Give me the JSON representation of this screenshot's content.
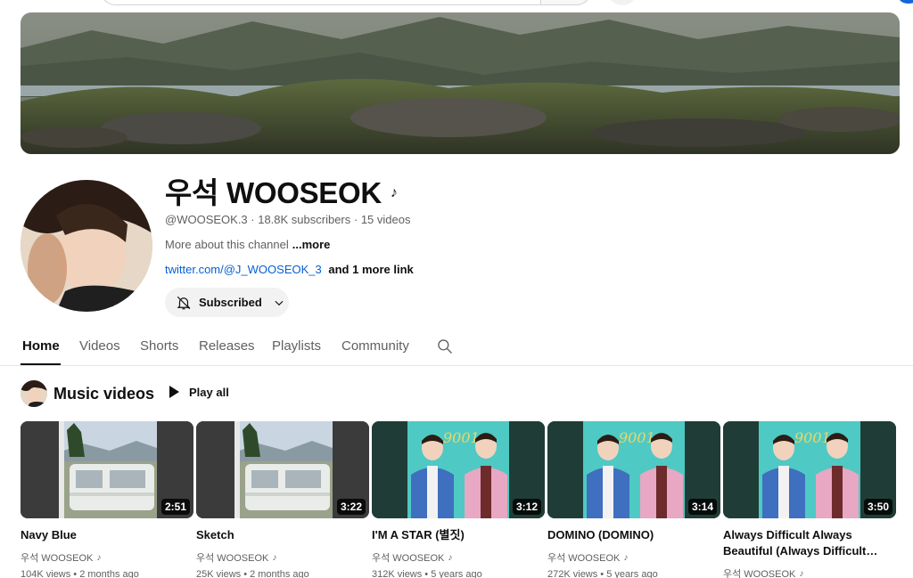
{
  "channel": {
    "name": "우석 WOOSEOK",
    "name_badge_icon": "music-note-icon",
    "handle_line": "@WOOSEOK.3 · 18.8K subscribers · 15 videos",
    "about": "More about this channel",
    "about_more": "...more",
    "link": "twitter.com/@J_WOOSEOK_3",
    "link_extra": "and 1 more link",
    "subscribe_label": "Subscribed"
  },
  "tabs": [
    {
      "label": "Home",
      "active": true
    },
    {
      "label": "Videos"
    },
    {
      "label": "Shorts"
    },
    {
      "label": "Releases"
    },
    {
      "label": "Playlists"
    },
    {
      "label": "Community"
    }
  ],
  "section": {
    "title": "Music videos",
    "play_all": "Play all"
  },
  "videos": [
    {
      "title": "Navy Blue",
      "duration": "2:51",
      "channel": "우석 WOOSEOK",
      "stats": "104K views • 2 months ago",
      "thumb": "car"
    },
    {
      "title": "Sketch",
      "duration": "3:22",
      "channel": "우석 WOOSEOK",
      "stats": "25K views • 2 months ago",
      "thumb": "car"
    },
    {
      "title": "I'M A STAR (별짓)",
      "duration": "3:12",
      "channel": "우석 WOOSEOK",
      "stats": "312K views • 5 years ago",
      "thumb": "duo"
    },
    {
      "title": "DOMINO (DOMINO)",
      "duration": "3:14",
      "channel": "우석 WOOSEOK",
      "stats": "272K views • 5 years ago",
      "thumb": "duo"
    },
    {
      "title": "Always Difficult Always Beautiful (Always Difficult…",
      "duration": "3:50",
      "channel": "우석 WOOSEOK",
      "stats": "",
      "thumb": "duo"
    }
  ],
  "colors": {
    "link": "#065fd4",
    "text": "#0f0f0f",
    "secondary": "#606060",
    "chip_bg": "#f2f2f2",
    "thumb_teal": "#1f3d36",
    "thumb_cyan": "#4fc9c4"
  }
}
